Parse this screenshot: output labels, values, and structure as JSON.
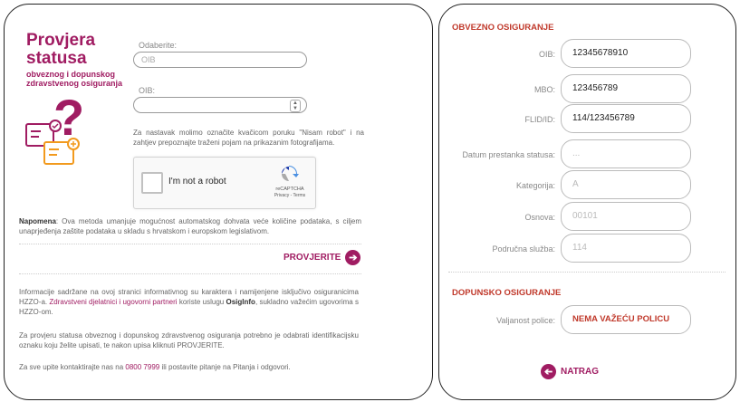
{
  "left": {
    "title_line1": "Provjera",
    "title_line2": "statusa",
    "subtitle_line1": "obveznog i dopunskog",
    "subtitle_line2": "zdravstvenog osiguranja",
    "select_label": "Odaberite:",
    "select_value": "OIB",
    "oib_label": "OIB:",
    "oib_value": "",
    "instructions": "Za nastavak molimo označite kvačicom poruku \"Nisam robot\" i na zahtjev prepoznajte traženi pojam na prikazanim fotografijama.",
    "captcha": {
      "label": "I'm not a robot",
      "brand": "reCAPTCHA",
      "links": "Privacy - Terms"
    },
    "note_bold": "Napomena",
    "note_text": ": Ova metoda umanjuje mogućnost automatskog dohvata veće količine podataka, s ciljem unaprjeđenja zaštite podataka u skladu s hrvatskom i europskom legislativom.",
    "submit_label": "PROVJERITE",
    "info1_a": "Informacije sadržane na ovoj stranici informativnog su karaktera i namijenjene isključivo osiguranicima HZZO-a. ",
    "info1_link": "Zdravstveni djelatnici i ugovorni partneri",
    "info1_b": " koriste uslugu ",
    "info1_bold": "OsigInfo",
    "info1_c": ", sukladno važećim ugovorima s HZZO-om.",
    "info2": "Za provjeru statusa obveznog i dopunskog zdravstvenog osiguranja potrebno je odabrati identifikacijsku oznaku koju želite upisati, te nakon upisa kliknuti PROVJERITE.",
    "info3_a": "Za sve upite kontaktirajte nas na ",
    "info3_phone": "0800 7999",
    "info3_b": " ili postavite pitanje na Pitanja i odgovori."
  },
  "right": {
    "section1": "OBVEZNO OSIGURANJE",
    "fields": [
      {
        "label": "OIB:",
        "value": "12345678910"
      },
      {
        "label": "MBO:",
        "value": "123456789"
      },
      {
        "label": "FLID/ID:",
        "value": "114/123456789"
      },
      {
        "label": "Datum prestanka statusa:",
        "value": "..."
      },
      {
        "label": "Kategorija:",
        "value": "A"
      },
      {
        "label": "Osnova:",
        "value": "00101"
      },
      {
        "label": "Područna služba:",
        "value": "114"
      }
    ],
    "section2": "DOPUNSKO OSIGURANJE",
    "policy_label": "Valjanost police:",
    "policy_value": "NEMA VAŽEĆU POLICU",
    "back_label": "NATRAG"
  },
  "colors": {
    "brand": "#a01c62",
    "section": "#c0392b",
    "icon_orange": "#f29a1e"
  }
}
